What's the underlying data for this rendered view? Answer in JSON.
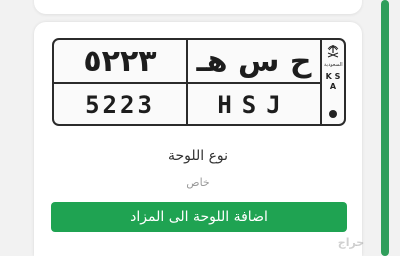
{
  "plate": {
    "arabic_numbers": "٥٢٢٣",
    "arabic_letters": "ح س هـ",
    "latin_numbers": "5223",
    "latin_letters": "HSJ",
    "side_arabic": "السعودية",
    "side_country": "K S A"
  },
  "plate_type": {
    "label": "نوع اللوحة",
    "value": "خاص"
  },
  "actions": {
    "add_to_auction": "اضافة اللوحة الى المزاد"
  },
  "watermark": "حراج",
  "colors": {
    "accent": "#1fa352",
    "scrollbar": "#2f9e5b"
  }
}
